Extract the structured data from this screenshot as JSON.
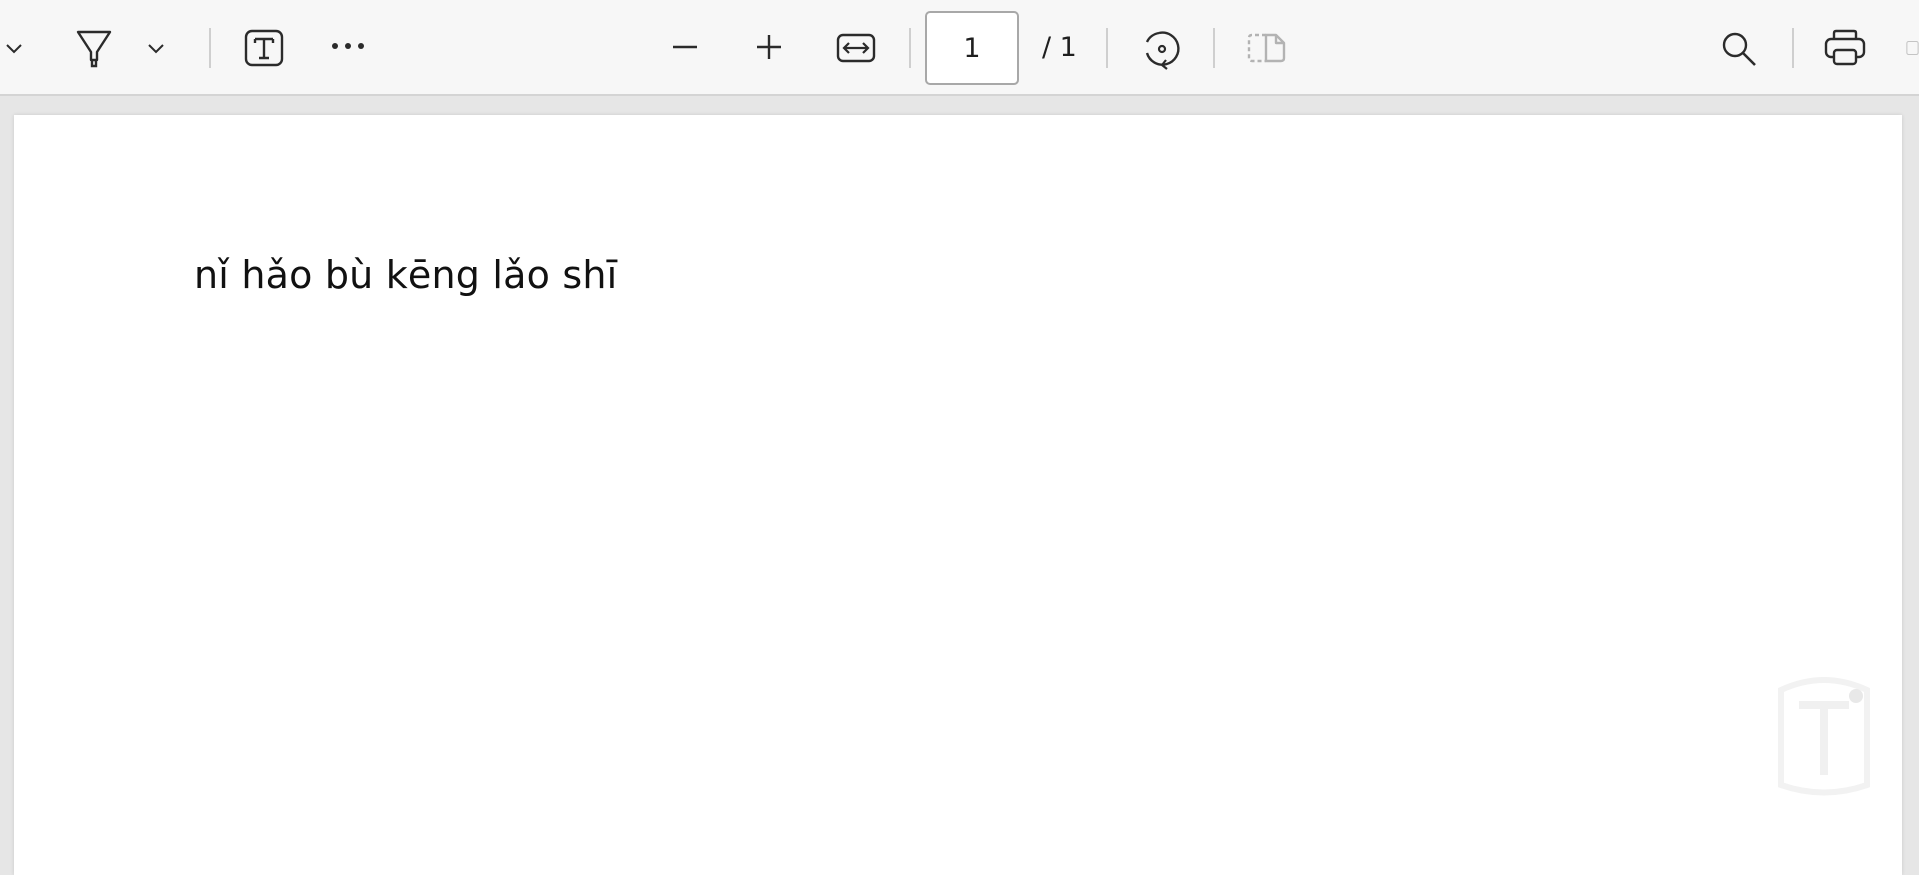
{
  "toolbar": {
    "icons": {
      "draw_menu": "chevron-down-icon",
      "highlight": "highlighter-icon",
      "highlight_menu": "chevron-down-icon",
      "text": "text-box-icon",
      "more": "more-icon",
      "zoom_out": "minus-icon",
      "zoom_in": "plus-icon",
      "fit": "fit-width-icon",
      "rotate": "rotate-icon",
      "page_view": "page-view-icon",
      "search": "search-icon",
      "print": "printer-icon"
    },
    "page_number": "1",
    "page_total": "/ 1"
  },
  "document": {
    "text": "nǐ hǎo bù kēng lǎo shī"
  },
  "colors": {
    "toolbar_bg": "#f7f7f7",
    "viewer_bg": "#e6e6e6",
    "page_bg": "#ffffff",
    "icon": "#2b2b2b",
    "icon_disabled": "#b3b3b3"
  }
}
